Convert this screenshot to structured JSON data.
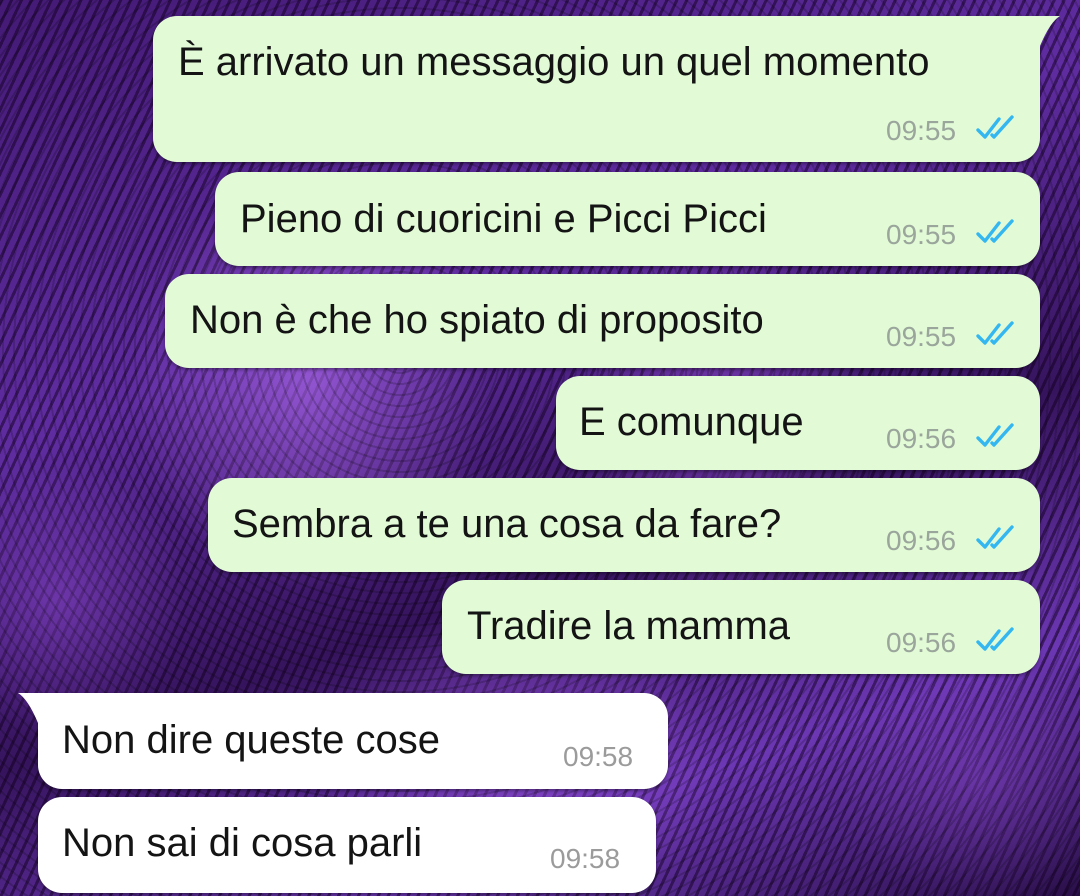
{
  "messages": [
    {
      "direction": "outgoing",
      "text": "È arrivato un messaggio un quel momento",
      "time": "09:55",
      "status": "read",
      "status_icon": "double-check-icon"
    },
    {
      "direction": "outgoing",
      "text": "Pieno di cuoricini e Picci Picci",
      "time": "09:55",
      "status": "read",
      "status_icon": "double-check-icon"
    },
    {
      "direction": "outgoing",
      "text": "Non è che ho spiato di proposito",
      "time": "09:55",
      "status": "read",
      "status_icon": "double-check-icon"
    },
    {
      "direction": "outgoing",
      "text": "E comunque",
      "time": "09:56",
      "status": "read",
      "status_icon": "double-check-icon"
    },
    {
      "direction": "outgoing",
      "text": "Sembra a te una cosa da fare?",
      "time": "09:56",
      "status": "read",
      "status_icon": "double-check-icon"
    },
    {
      "direction": "outgoing",
      "text": "Tradire la mamma",
      "time": "09:56",
      "status": "read",
      "status_icon": "double-check-icon"
    },
    {
      "direction": "incoming",
      "text": "Non dire queste cose",
      "time": "09:58"
    },
    {
      "direction": "incoming",
      "text": "Non sai di cosa parli",
      "time": "09:58"
    }
  ],
  "colors": {
    "outgoing_bubble": "#e2fbd6",
    "incoming_bubble": "#ffffff",
    "read_ticks": "#34b7f1",
    "timestamp": "#9aa59b",
    "wallpaper_tint": "#6a36b0"
  }
}
